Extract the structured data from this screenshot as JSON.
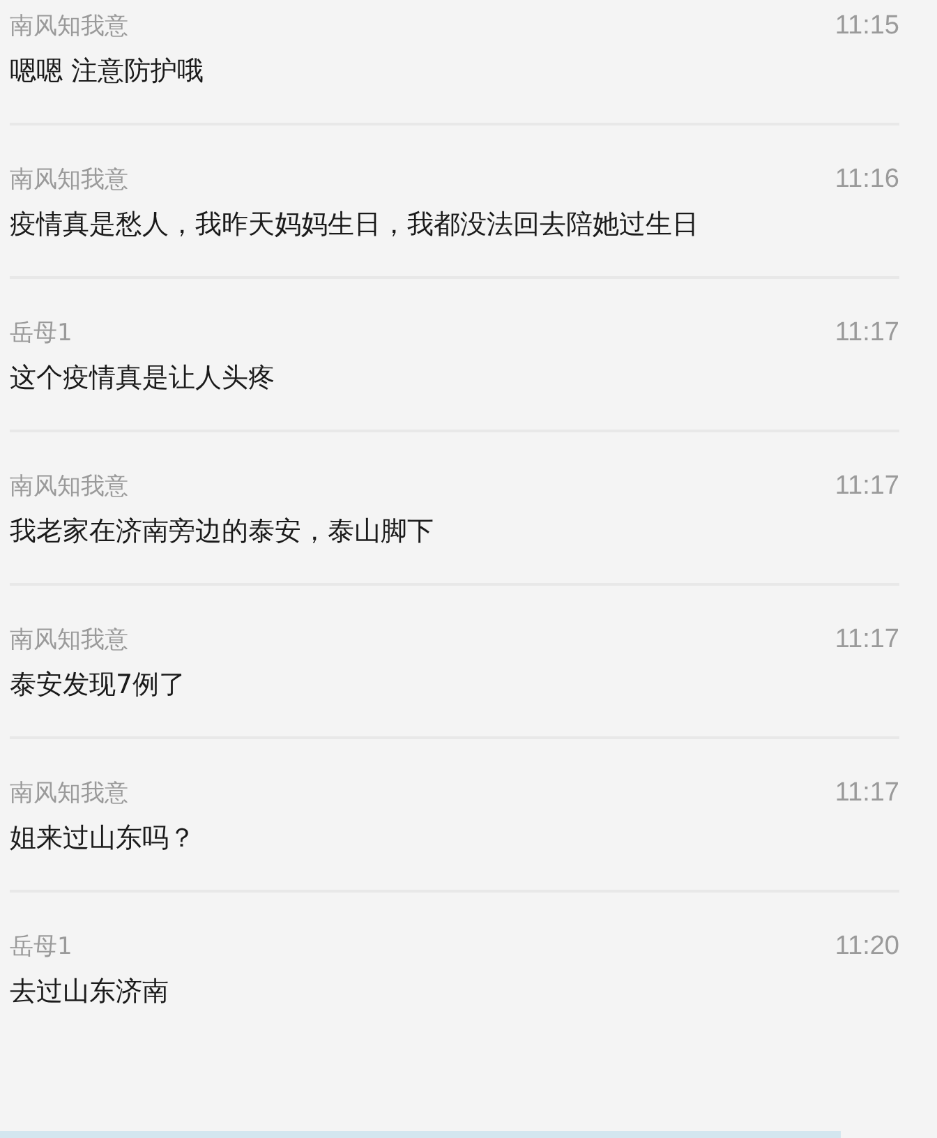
{
  "messages": [
    {
      "sender": "南风知我意",
      "time": "11:15",
      "text": "嗯嗯 注意防护哦"
    },
    {
      "sender": "南风知我意",
      "time": "11:16",
      "text": "疫情真是愁人，我昨天妈妈生日，我都没法回去陪她过生日"
    },
    {
      "sender": "岳母1",
      "time": "11:17",
      "text": "这个疫情真是让人头疼"
    },
    {
      "sender": "南风知我意",
      "time": "11:17",
      "text": "我老家在济南旁边的泰安，泰山脚下"
    },
    {
      "sender": "南风知我意",
      "time": "11:17",
      "text": "泰安发现7例了"
    },
    {
      "sender": "南风知我意",
      "time": "11:17",
      "text": "姐来过山东吗？"
    },
    {
      "sender": "岳母1",
      "time": "11:20",
      "text": "去过山东济南"
    }
  ]
}
